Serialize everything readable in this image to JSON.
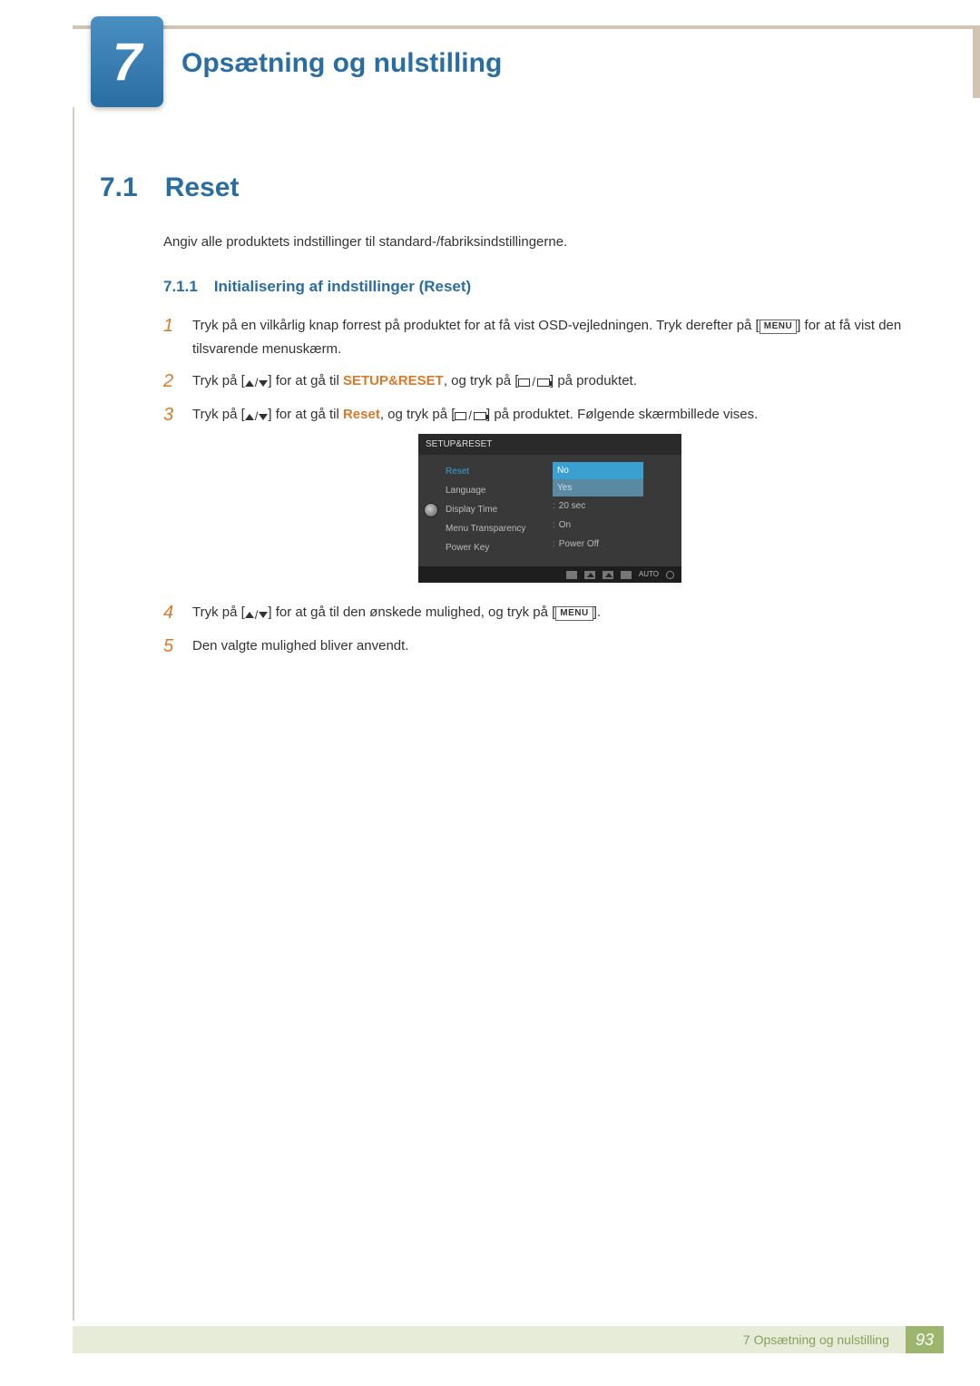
{
  "chapter": {
    "number": "7",
    "title": "Opsætning og nulstilling"
  },
  "section": {
    "number": "7.1",
    "title": "Reset",
    "intro": "Angiv alle produktets indstillinger til standard-/fabriksindstillingerne."
  },
  "subsection": {
    "number": "7.1.1",
    "title": "Initialisering af indstillinger (Reset)"
  },
  "steps": {
    "s1": {
      "num": "1",
      "a": "Tryk på en vilkårlig knap forrest på produktet for at få vist OSD-vejledningen. Tryk derefter på [",
      "b": "] for at få vist den tilsvarende menuskærm."
    },
    "s2": {
      "num": "2",
      "a": "Tryk på [",
      "b": "] for at gå til ",
      "kw": "SETUP&RESET",
      "c": ", og tryk på [",
      "d": "] på produktet."
    },
    "s3": {
      "num": "3",
      "a": "Tryk på [",
      "b": "] for at gå til ",
      "kw": "Reset",
      "c": ", og tryk på [",
      "d": "] på produktet. Følgende skærmbillede vises."
    },
    "s4": {
      "num": "4",
      "a": "Tryk på [",
      "b": "] for at gå til den ønskede mulighed, og tryk på [",
      "c": "]."
    },
    "s5": {
      "num": "5",
      "a": "Den valgte mulighed bliver anvendt."
    }
  },
  "menu_label": "MENU",
  "osd": {
    "title": "SETUP&RESET",
    "items": {
      "reset": "Reset",
      "language": "Language",
      "display_time": "Display Time",
      "menu_transparency": "Menu Transparency",
      "power_key": "Power Key"
    },
    "options": {
      "no": "No",
      "yes": "Yes"
    },
    "values": {
      "display_time": "20 sec",
      "menu_transparency": "On",
      "power_key": "Power Off"
    },
    "auto": "AUTO"
  },
  "footer": {
    "label": "7 Opsætning og nulstilling",
    "page": "93"
  }
}
